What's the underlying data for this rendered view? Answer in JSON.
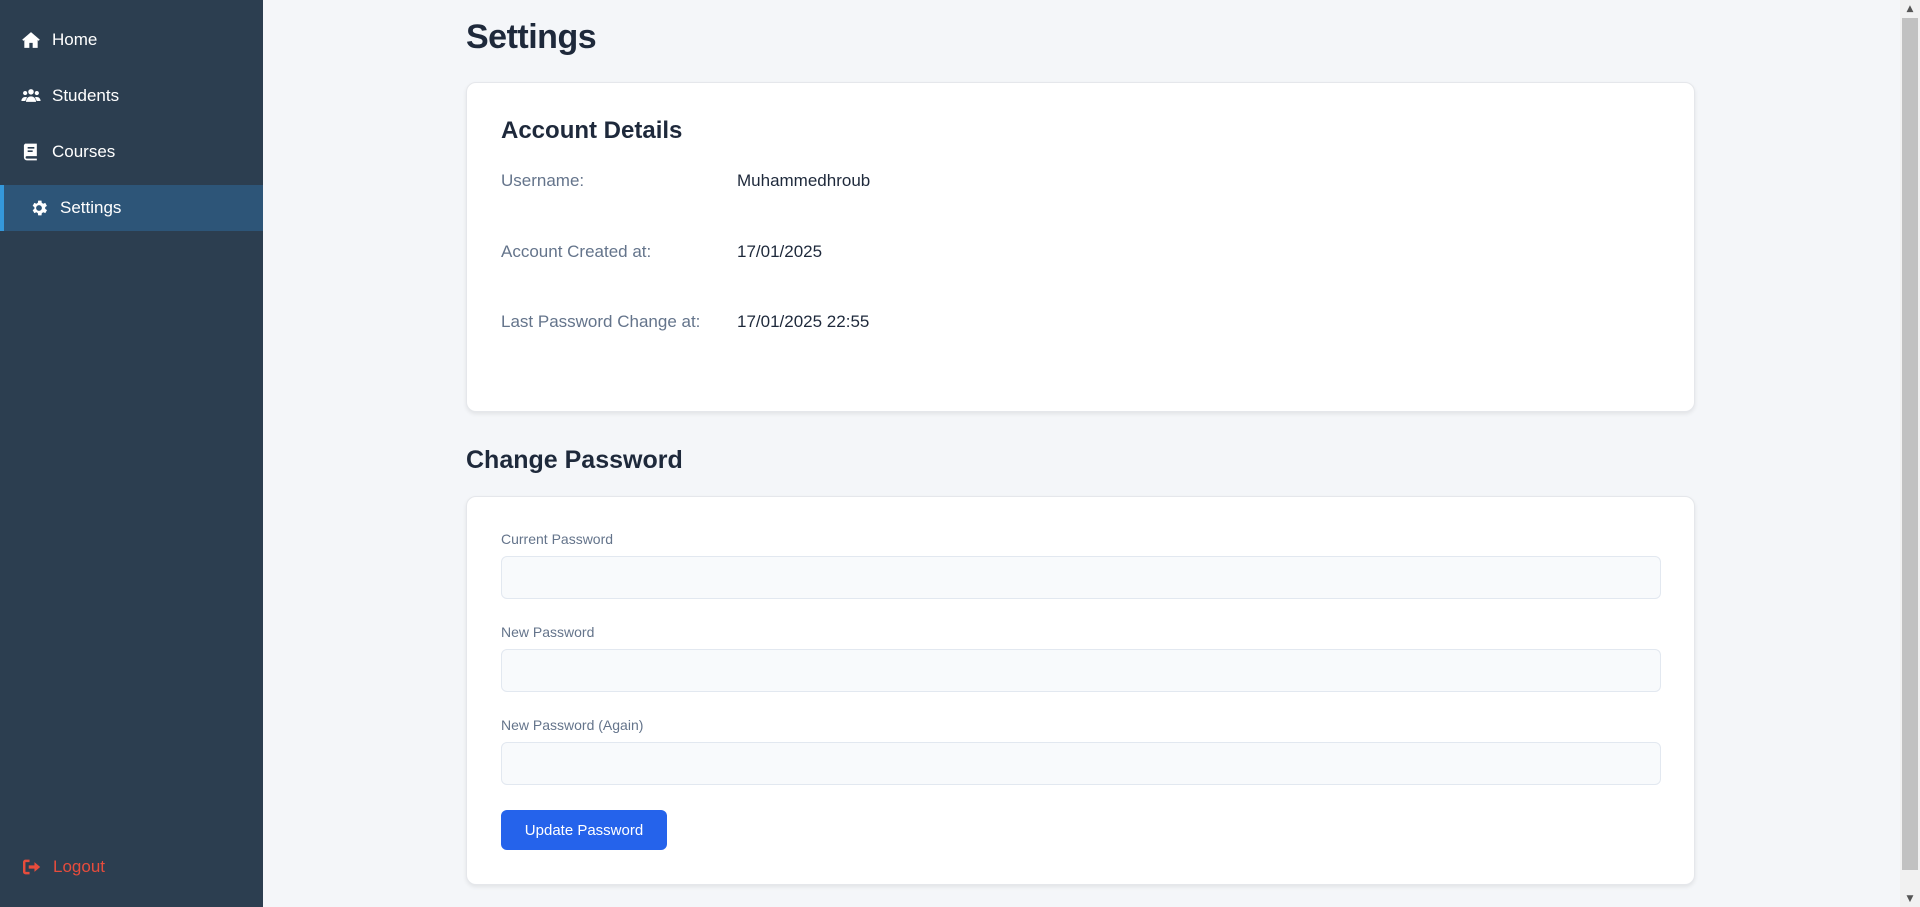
{
  "sidebar": {
    "items": [
      {
        "label": "Home",
        "icon": "home-icon"
      },
      {
        "label": "Students",
        "icon": "users-icon"
      },
      {
        "label": "Courses",
        "icon": "book-icon"
      },
      {
        "label": "Settings",
        "icon": "gear-icon",
        "active": true
      }
    ],
    "logout_label": "Logout",
    "logout_icon": "logout-icon"
  },
  "page": {
    "title": "Settings"
  },
  "account": {
    "title": "Account Details",
    "rows": [
      {
        "label": "Username:",
        "value": "Muhammedhroub"
      },
      {
        "label": "Account Created at:",
        "value": "17/01/2025"
      },
      {
        "label": "Last Password Change at:",
        "value": "17/01/2025 22:55"
      }
    ]
  },
  "password": {
    "title": "Change Password",
    "fields": [
      {
        "label": "Current Password",
        "value": ""
      },
      {
        "label": "New Password",
        "value": ""
      },
      {
        "label": "New Password (Again)",
        "value": ""
      }
    ],
    "submit_label": "Update Password"
  },
  "colors": {
    "sidebar_bg": "#2c3e50",
    "active_bg": "#2d5578",
    "active_accent": "#3498db",
    "logout": "#e74c3c",
    "primary_button": "#2563eb",
    "page_bg": "#f4f6f9"
  }
}
